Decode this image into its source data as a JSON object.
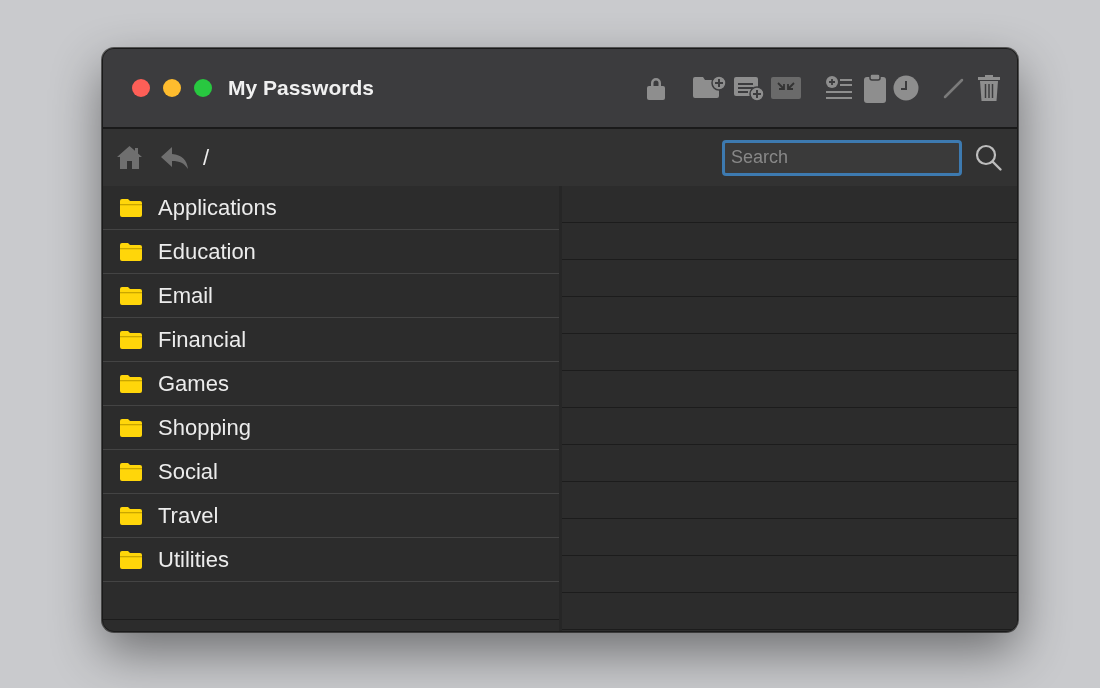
{
  "window": {
    "title": "My Passwords"
  },
  "path": "/",
  "search": {
    "placeholder": "Search"
  },
  "folders": [
    {
      "name": "Applications",
      "selected": false
    },
    {
      "name": "Education",
      "selected": false
    },
    {
      "name": "Email",
      "selected": false
    },
    {
      "name": "Financial",
      "selected": false
    },
    {
      "name": "Games",
      "selected": false
    },
    {
      "name": "Shopping",
      "selected": false
    },
    {
      "name": "Social",
      "selected": false
    },
    {
      "name": "Travel",
      "selected": false
    },
    {
      "name": "Utilities",
      "selected": false
    }
  ]
}
